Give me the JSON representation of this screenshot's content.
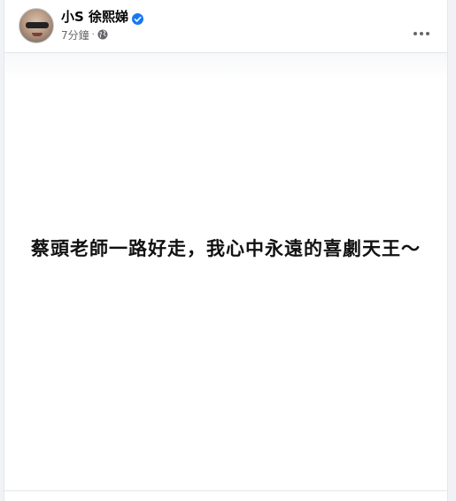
{
  "post": {
    "author": {
      "name": "小S 徐熙娣",
      "verified_icon": "verified-badge-icon",
      "avatar_icon": "profile-photo"
    },
    "meta": {
      "time": "7分鐘",
      "separator": "·",
      "privacy_icon": "globe-icon"
    },
    "menu_icon": "more-options-icon",
    "image_text": "蔡頭老師一路好走，我心中永遠的喜劇天王～"
  },
  "colors": {
    "verified_blue": "#1877f2",
    "meta_gray": "#65676b",
    "name_black": "#050505",
    "background": "#f0f2f5"
  }
}
